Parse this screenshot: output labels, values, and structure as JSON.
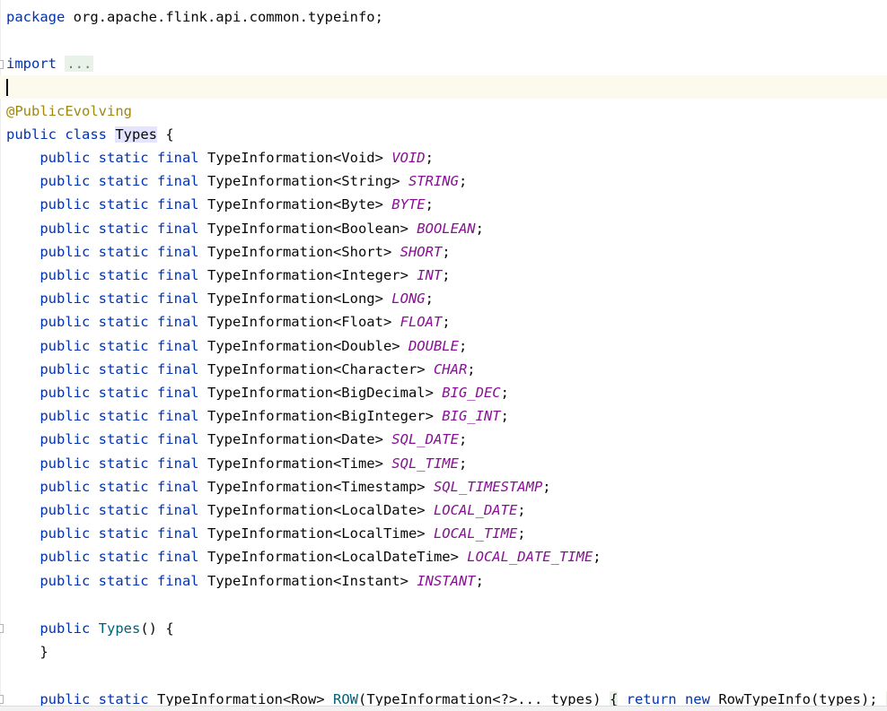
{
  "editor": {
    "package_kw": "package",
    "package_name": "org.apache.flink.api.common.typeinfo;",
    "import_kw": "import",
    "import_folded": "...",
    "annotation": "@PublicEvolving",
    "class_kw": "public class",
    "class_name": "Types",
    "open_brace": "{",
    "modifiers": "public static final",
    "fields": [
      {
        "type": "TypeInformation<Void>",
        "name": "VOID"
      },
      {
        "type": "TypeInformation<String>",
        "name": "STRING"
      },
      {
        "type": "TypeInformation<Byte>",
        "name": "BYTE"
      },
      {
        "type": "TypeInformation<Boolean>",
        "name": "BOOLEAN"
      },
      {
        "type": "TypeInformation<Short>",
        "name": "SHORT"
      },
      {
        "type": "TypeInformation<Integer>",
        "name": "INT"
      },
      {
        "type": "TypeInformation<Long>",
        "name": "LONG"
      },
      {
        "type": "TypeInformation<Float>",
        "name": "FLOAT"
      },
      {
        "type": "TypeInformation<Double>",
        "name": "DOUBLE"
      },
      {
        "type": "TypeInformation<Character>",
        "name": "CHAR"
      },
      {
        "type": "TypeInformation<BigDecimal>",
        "name": "BIG_DEC"
      },
      {
        "type": "TypeInformation<BigInteger>",
        "name": "BIG_INT"
      },
      {
        "type": "TypeInformation<Date>",
        "name": "SQL_DATE"
      },
      {
        "type": "TypeInformation<Time>",
        "name": "SQL_TIME"
      },
      {
        "type": "TypeInformation<Timestamp>",
        "name": "SQL_TIMESTAMP"
      },
      {
        "type": "TypeInformation<LocalDate>",
        "name": "LOCAL_DATE"
      },
      {
        "type": "TypeInformation<LocalTime>",
        "name": "LOCAL_TIME"
      },
      {
        "type": "TypeInformation<LocalDateTime>",
        "name": "LOCAL_DATE_TIME"
      },
      {
        "type": "TypeInformation<Instant>",
        "name": "INSTANT"
      }
    ],
    "semicolon": ";",
    "ctor_kw": "public",
    "ctor_name": "Types",
    "ctor_rest": "() {",
    "close_brace": "}",
    "row_modifiers": "public static",
    "row_type": "TypeInformation<Row>",
    "row_name": "ROW",
    "row_params": "(TypeInformation<?>... types)",
    "row_open": "{",
    "row_return_kw": "return new",
    "row_body": "RowTypeInfo(types);",
    "row_close": "}"
  },
  "colors": {
    "keyword": "#0033b3",
    "annotation": "#9e880d",
    "constant": "#871094",
    "method": "#00627a",
    "current_line": "#fcfaed",
    "identifier_highlight": "#e4e4ff"
  }
}
